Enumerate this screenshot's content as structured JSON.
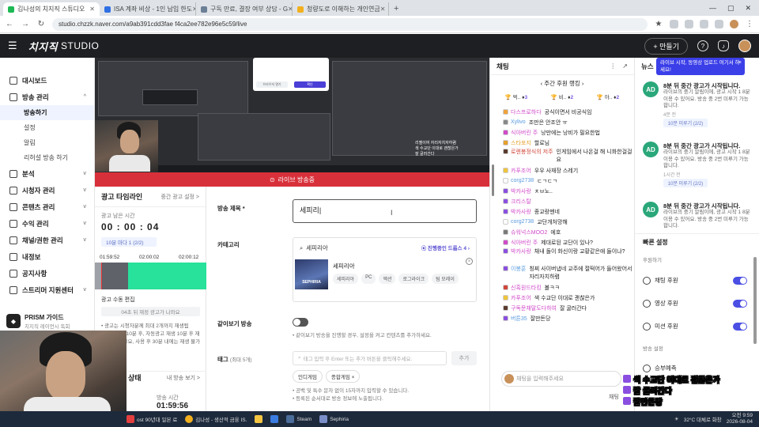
{
  "browser": {
    "tabs": [
      {
        "label": "김나성의 치지직 스튜디오",
        "color": "#1db954",
        "active": true
      },
      {
        "label": "ISA 계좌 비상 - 1인 납입 한도",
        "color": "#2f6fe4",
        "active": false
      },
      {
        "label": "구독 만료, 결장 여부 상담 - G",
        "color": "#6b7f95",
        "active": false
      },
      {
        "label": "청량도로 이해하는 개인연금",
        "color": "#f2b01e",
        "active": false
      }
    ],
    "url": "studio.chzzk.naver.com/a9ab391cdd3fae f4ca2ee782e96e5c59/live"
  },
  "header": {
    "logo": "치지직",
    "logo_suffix": "STUDIO",
    "make_button": "+ 만들기"
  },
  "sidebar": {
    "items": [
      {
        "label": "대시보드"
      },
      {
        "label": "방송 관리",
        "chev": "^"
      },
      {
        "label": "분석",
        "chev": "v"
      },
      {
        "label": "시청자 관리",
        "chev": "v"
      },
      {
        "label": "콘텐츠 관리",
        "chev": "v"
      },
      {
        "label": "수익 관리",
        "chev": "v"
      },
      {
        "label": "채널/권한 관리",
        "chev": "v"
      },
      {
        "label": "내정보"
      },
      {
        "label": "공지사항"
      },
      {
        "label": "스트리머 지원센터",
        "chev": "v"
      }
    ],
    "subitems": [
      "방송하기",
      "설정",
      "알림",
      "리허설 방송 하기"
    ],
    "prism_title": "PRISM 가이드",
    "prism_sub": "치지직 레이언시 독회"
  },
  "preview": {
    "dialog_cancel": "브라우저 열기",
    "dialog_ok": "확인",
    "chat_lines": [
      "리젤이여 자리자치자하렴",
      "색 수교단 이대로 괜찮은가",
      "잘 굴러간다"
    ],
    "live_label": "라이브 방송중"
  },
  "ad": {
    "title": "광고 타임라인",
    "sub": "중간 광고 설정 >",
    "remaining_label": "광고 남은 시간",
    "timer": "00 : 00 : 04",
    "pill": "10분 마다 1 (2/2)",
    "ticks": [
      "01:59:52",
      "02:00:02",
      "02:00:12"
    ],
    "suffix_label": "광고 수동 편집",
    "suffix_pill": "04초 뒤 재정 광고가 나와요",
    "notes": [
      "• 광고는 시청자분께 최대 2개까지 재생됨",
      "• 방송 시작 10분 후, 자동광고 재생 10분 후 재생할 수 있고요, 사용 후 30분 내에는 재생 불가"
    ],
    "status_title": "상태",
    "status_more": "내 방송 보기 >",
    "status_col": "방송 시간",
    "status_time": "01:59:56"
  },
  "form": {
    "title_label": "방송 제목",
    "title_value": "세피리|",
    "category_label": "카테고리",
    "category_search": "세피리아",
    "category_promo": "진행중인 드롭스 4",
    "category_name": "세피리아",
    "category_tags": [
      "세피리아",
      "PC",
      "액션",
      "로그라이크",
      "팀 모레이"
    ],
    "thumb_text": "SEPHIRIA",
    "mosaic_label": "같이보기 방송",
    "mosaic_hint": "• 같이보기 방송을 진행할 경우, 설정을 켜고 컨텐츠를 추가하세요.",
    "tag_label": "태그",
    "tag_label_sm": "(최대 5개)",
    "tag_placeholder": "태그 입력 후 Enter 또는 추가 버튼을 클릭해주세요.",
    "tag_add": "추가",
    "chips": [
      "인디게임",
      "종합게임 ×"
    ],
    "tag_hints": [
      "• 공백 및 특수 문자 없이 15자까지 입력할 수 있습니다.",
      "• 등록된 순서대로 방송 정보에 노출됩니다."
    ]
  },
  "chat": {
    "title": "채팅",
    "rank_title": "주간 후원 랭킹",
    "rank": [
      {
        "name": "먹.. ",
        "count": "3"
      },
      {
        "name": "비.. ",
        "count": "2"
      },
      {
        "name": "아.. ",
        "count": "2"
      }
    ],
    "messages": [
      {
        "nick": "다스프로하다",
        "text": "공식이면서 비공식임",
        "nick_color": "#d04ac9",
        "badge": "#f0a23a"
      },
      {
        "nick": "Xylivo",
        "text": "조만은 안조안 ㅠ",
        "nick_color": "#5a9be0",
        "badge": "#888"
      },
      {
        "nick": "식아버린 주",
        "text": "낭만에는 낭비가 필요한법",
        "nick_color": "#d04ac9",
        "badge": "#d04ac9"
      },
      {
        "nick": "스타포지",
        "text": "할로님",
        "nick_color": "#e6a02b",
        "badge": "#e6a02b"
      },
      {
        "nick": "로렌봉정식의 저주",
        "text": "인게임에서 나온걸 해 니화한걸걸요",
        "nick_color": "#d0463a",
        "badge": "#5a3b2d",
        "two": true
      },
      {
        "nick": "카푸조어",
        "text": "우우 사재장 스레기",
        "nick_color": "#d04ac9",
        "badge": "#f0c43a"
      },
      {
        "nick": "corg2738",
        "text": "ㄷㄱㄷㄱ",
        "nick_color": "#5a9be0",
        "badge": "#fff"
      },
      {
        "nick": "박카사랑",
        "text": "ㅊㅂ노..",
        "nick_color": "#d04ac9",
        "badge": "#8a4fe0"
      },
      {
        "nick": "크리스탈",
        "text": "",
        "nick_color": "#d04ac9",
        "badge": "#8a4fe0"
      },
      {
        "nick": "박카사랑",
        "text": "종교랑멘네",
        "nick_color": "#d04ac9",
        "badge": "#8a4fe0"
      },
      {
        "nick": "corg2738",
        "text": "교단개처망해",
        "nick_color": "#5a9be0",
        "badge": "#fff"
      },
      {
        "nick": "슈워넉스MOO2",
        "text": "에호",
        "nick_color": "#d04ac9",
        "badge": "#7a7a7a"
      },
      {
        "nick": "식아버린 주",
        "text": "제대로된 교단이 있나?",
        "nick_color": "#d04ac9",
        "badge": "#d04ac9"
      },
      {
        "nick": "박카사랑",
        "text": "채내 돌이 화신이랑 교황같은애 들이냐?",
        "nick_color": "#d04ac9",
        "badge": "#8a4fe0",
        "two": true
      },
      {
        "nick": "이봉훈",
        "text": "칭찌 사이버냅네 교주에 절떡어가 들어왔어서 자리자치하렴",
        "nick_color": "#5a9be0",
        "badge": "#8a4fe0",
        "two": true
      },
      {
        "nick": "신혹원드타킹",
        "text": "볼ㅋㅋ",
        "nick_color": "#d04ac9",
        "badge": "#d0463a"
      },
      {
        "nick": "카푸조어",
        "text": "색 수교단 이대로 괜찮은가",
        "nick_color": "#d04ac9",
        "badge": "#f0c43a"
      },
      {
        "nick": "구독문채말도다하여",
        "text": "잘 굴러간다",
        "nick_color": "#d04ac9",
        "badge": "#5a3b2d"
      },
      {
        "nick": "버튼35",
        "text": "잘만돈당",
        "nick_color": "#5a9be0",
        "badge": "#8a4fe0"
      }
    ],
    "input_placeholder": "채팅을 입력해주세요",
    "send": "채팅"
  },
  "right": {
    "title": "뉴스",
    "tooltip": "라이브 시작, 동영상 업로드 여기서 하세요!",
    "tooltip_close": "×",
    "news": [
      {
        "av": "AD",
        "title": "8분 뒤 중간 광고가 시작됩니다.",
        "body": "라이브의 중기 알림이에, 광고 시작 1 8분 이용 수 있어요. 방송 중 2번 미루기 가능합니다.",
        "time": "4분 전",
        "pill": "10분 미루기 (2/2)"
      },
      {
        "av": "AD",
        "title": "8분 뒤 중간 광고가 시작됩니다.",
        "body": "라이브의 중기 알림이에, 광고 시작 1 8분 이용 수 있어요. 방송 중 2번 미루기 가능합니다.",
        "time": "1시간 전",
        "pill": "10분 미루기 (2/2)"
      },
      {
        "av": "AD",
        "title": "8분 뒤 중간 광고가 시작됩니다.",
        "body": "라이브의 중기 알림이에, 광고 시작 1 8분 이용 수 있어요. 방송 중 2번 미루기 가능합니다.",
        "time": "",
        "pill": ""
      }
    ],
    "quick_title": "빠른 설정",
    "donation_sub": "후원하기",
    "toggles": [
      {
        "label": "채팅 후원"
      },
      {
        "label": "영상 후원"
      },
      {
        "label": "미션 후원"
      }
    ],
    "broadcast_sub": "방송 설정",
    "bet_label": "승부예측"
  },
  "overlay_subs": [
    "색 수교단 이대로 괜찮은가",
    "잘 굴러간다",
    "잘만돈당"
  ],
  "taskbar": {
    "apps": [
      "ost 90년대 일본 료",
      "김나성 - 생산적 금융 IS.",
      "Steam",
      "Sephiria"
    ],
    "weather": "32°C 대체로 화창",
    "time": "오전 9:59",
    "date": "2026-08-04"
  }
}
